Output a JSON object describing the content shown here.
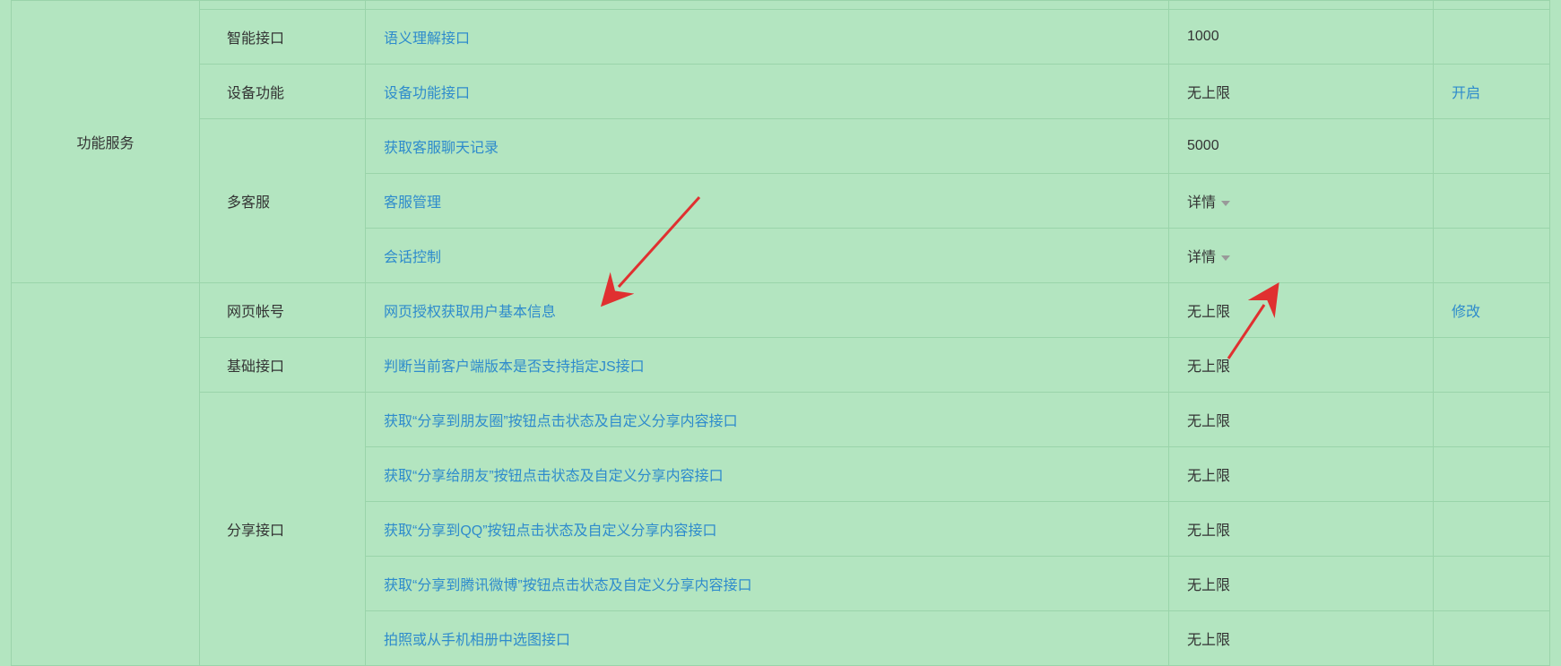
{
  "groups": {
    "function_service": "功能服务"
  },
  "categories": {
    "smart_interface": "智能接口",
    "device_function": "设备功能",
    "multi_cs": "多客服",
    "web_account": "网页帐号",
    "basic_interface": "基础接口",
    "share_interface": "分享接口"
  },
  "rows": [
    {
      "api": "语义理解接口",
      "quota": "1000",
      "action": ""
    },
    {
      "api": "设备功能接口",
      "quota": "无上限",
      "action": "开启"
    },
    {
      "api": "获取客服聊天记录",
      "quota": "5000",
      "action": ""
    },
    {
      "api": "客服管理",
      "quota": "详情",
      "action": "",
      "caret": true
    },
    {
      "api": "会话控制",
      "quota": "详情",
      "action": "",
      "caret": true
    },
    {
      "api": "网页授权获取用户基本信息",
      "quota": "无上限",
      "action": "修改"
    },
    {
      "api": "判断当前客户端版本是否支持指定JS接口",
      "quota": "无上限",
      "action": ""
    },
    {
      "api": "获取“分享到朋友圈”按钮点击状态及自定义分享内容接口",
      "quota": "无上限",
      "action": ""
    },
    {
      "api": "获取“分享给朋友”按钮点击状态及自定义分享内容接口",
      "quota": "无上限",
      "action": ""
    },
    {
      "api": "获取“分享到QQ”按钮点击状态及自定义分享内容接口",
      "quota": "无上限",
      "action": ""
    },
    {
      "api": "获取“分享到腾讯微博”按钮点击状态及自定义分享内容接口",
      "quota": "无上限",
      "action": ""
    },
    {
      "api": "拍照或从手机相册中选图接口",
      "quota": "无上限",
      "action": ""
    }
  ]
}
